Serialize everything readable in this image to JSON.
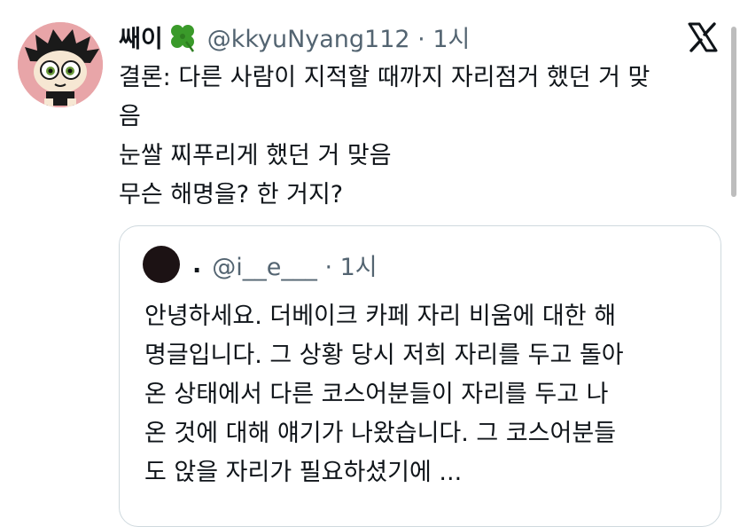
{
  "tweet": {
    "display_name": "쌔이",
    "handle_time": "@kkyuNyang112 · 1시",
    "text_lines": [
      "결론: 다른 사람이 지적할 때까지 자리점거 했던 거 맞",
      "음",
      "눈쌀 찌푸리게 했던 거 맞음",
      "무슨 해명을? 한 거지?"
    ]
  },
  "quote": {
    "dot": ".",
    "handle_time": "@i__e___ · 1시",
    "text_lines": [
      "안녕하세요. 더베이크 카페 자리 비움에 대한 해",
      "명글입니다. 그 상황 당시 저희 자리를 두고 돌아",
      "온 상태에서 다른 코스어분들이 자리를 두고 나",
      "온 것에 대해 얘기가 나왔습니다. 그 코스어분들",
      "도 앉을 자리가 필요하셨기에  ..."
    ]
  },
  "colors": {
    "text": "#0f1419",
    "secondary": "#536471",
    "border": "#cfd9de",
    "avatar_bg": "#e8a5a8"
  },
  "icons": {
    "brand": "x-logo-icon",
    "emoji": "four-leaf-clover-icon"
  }
}
